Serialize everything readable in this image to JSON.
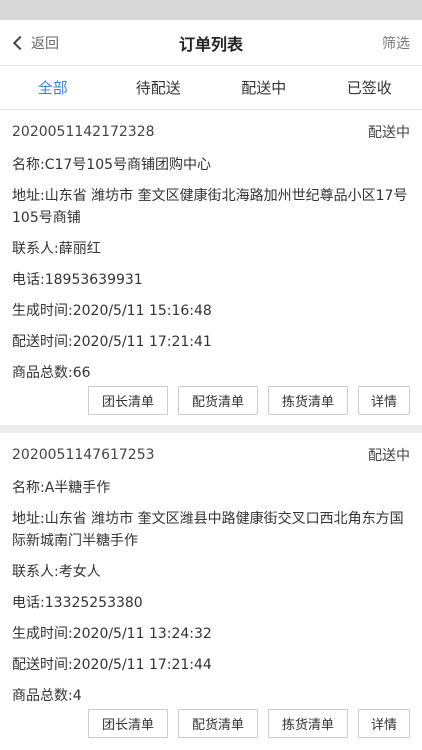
{
  "nav": {
    "back_label": "返回",
    "title": "订单列表",
    "filter_label": "筛选"
  },
  "tabs": [
    {
      "label": "全部",
      "active": true
    },
    {
      "label": "待配送",
      "active": false
    },
    {
      "label": "配送中",
      "active": false
    },
    {
      "label": "已签收",
      "active": false
    }
  ],
  "orders": [
    {
      "order_no": "2020051142172328",
      "status": "配送中",
      "name": "名称:C17号105号商铺团购中心",
      "address": "地址:山东省 潍坊市 奎文区健康街北海路加州世纪尊品小区17号105号商铺",
      "contact": "联系人:薛丽红",
      "phone": "电话:18953639931",
      "created": "生成时间:2020/5/11 15:16:48",
      "delivery": "配送时间:2020/5/11 17:21:41",
      "total": "商品总数:66"
    },
    {
      "order_no": "2020051147617253",
      "status": "配送中",
      "name": "名称:A半糖手作",
      "address": "地址:山东省 潍坊市 奎文区潍县中路健康街交叉口西北角东方国际新城南门半糖手作",
      "contact": "联系人:考女人",
      "phone": "电话:13325253380",
      "created": "生成时间:2020/5/11 13:24:32",
      "delivery": "配送时间:2020/5/11 17:21:44",
      "total": "商品总数:4"
    }
  ],
  "actions": {
    "leader_list": "团长清单",
    "distribution_list": "配货清单",
    "picking_list": "拣货清单",
    "details": "详情"
  }
}
